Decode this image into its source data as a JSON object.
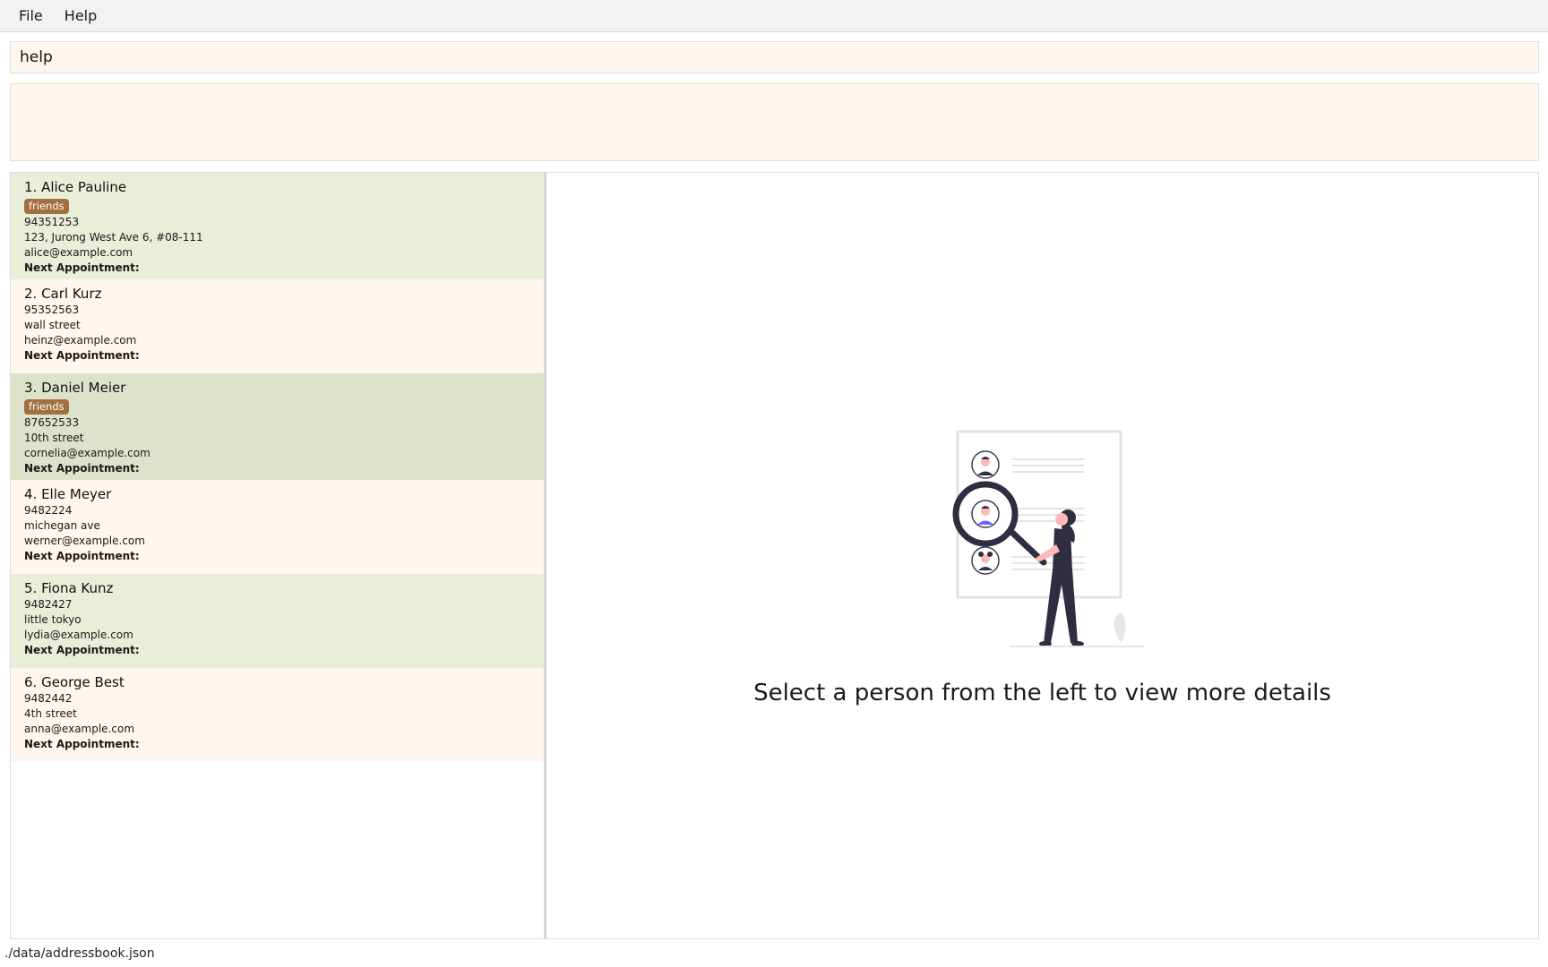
{
  "menu": {
    "file": "File",
    "help": "Help"
  },
  "command": {
    "value": "help"
  },
  "result": {
    "text": ""
  },
  "persons": [
    {
      "name": "1. Alice Pauline",
      "tags": [
        "friends"
      ],
      "phone": "94351253",
      "address": "123, Jurong West Ave 6, #08-111",
      "email": "alice@example.com",
      "appointment": "Next Appointment:"
    },
    {
      "name": "2. Carl Kurz",
      "tags": [],
      "phone": "95352563",
      "address": "wall street",
      "email": "heinz@example.com",
      "appointment": "Next Appointment:"
    },
    {
      "name": "3. Daniel Meier",
      "tags": [
        "friends"
      ],
      "phone": "87652533",
      "address": "10th street",
      "email": "cornelia@example.com",
      "appointment": "Next Appointment:"
    },
    {
      "name": "4. Elle Meyer",
      "tags": [],
      "phone": "9482224",
      "address": "michegan ave",
      "email": "werner@example.com",
      "appointment": "Next Appointment:"
    },
    {
      "name": "5. Fiona Kunz",
      "tags": [],
      "phone": "9482427",
      "address": "little tokyo",
      "email": "lydia@example.com",
      "appointment": "Next Appointment:"
    },
    {
      "name": "6. George Best",
      "tags": [],
      "phone": "9482442",
      "address": "4th street",
      "email": "anna@example.com",
      "appointment": "Next Appointment:"
    }
  ],
  "detail": {
    "placeholder": "Select a person from the left to view more details",
    "illustration_icon": "person-search-illustration"
  },
  "status": {
    "path": "./data/addressbook.json"
  },
  "colors": {
    "tag": "#a2703e",
    "card_green": "#e9eed9",
    "card_cream": "#fff6ef",
    "card_selected": "#dde3ca"
  }
}
